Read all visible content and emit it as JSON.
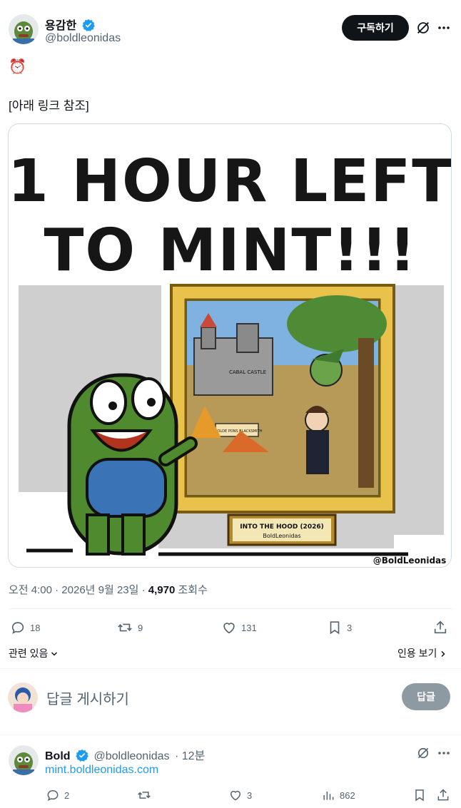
{
  "post": {
    "author_name": "용감한",
    "author_handle": "@boldleonidas",
    "subscribe_label": "구독하기",
    "emoji": "⏰",
    "body_text": "[아래 링크 참조]",
    "image": {
      "headline_line1": "1 HOUR LEFT",
      "headline_line2": "TO MINT!!!",
      "plaque_line1": "INTO THE HOOD (2026)",
      "plaque_line2": "BoldLeonidas",
      "watermark": "@BoldLeonidas",
      "sign_castle": "CABAL CASTLE",
      "sign_shop": "YE OLDE PONS BLACKSMITH"
    },
    "timestamp": "오전 4:00 · 2026년 9월 23일 · ",
    "views_count": "4,970",
    "views_label": " 조회수",
    "actions": {
      "replies": "18",
      "reposts": "9",
      "likes": "131",
      "bookmarks": "3"
    },
    "related_label": "관련 있음",
    "quotes_label": "인용 보기"
  },
  "reply_box": {
    "placeholder": "답글 게시하기",
    "submit_label": "답글"
  },
  "reply": {
    "author_name": "Bold",
    "author_handle": "@boldleonidas",
    "time": "· 12분",
    "link_text": "mint.boldleonidas.com",
    "actions": {
      "replies": "2",
      "reposts": "",
      "likes": "3",
      "views": "862"
    }
  },
  "colors": {
    "verified_blue": "#1d9bf0",
    "link_blue": "#1d9bf0",
    "text_secondary": "#536471"
  }
}
